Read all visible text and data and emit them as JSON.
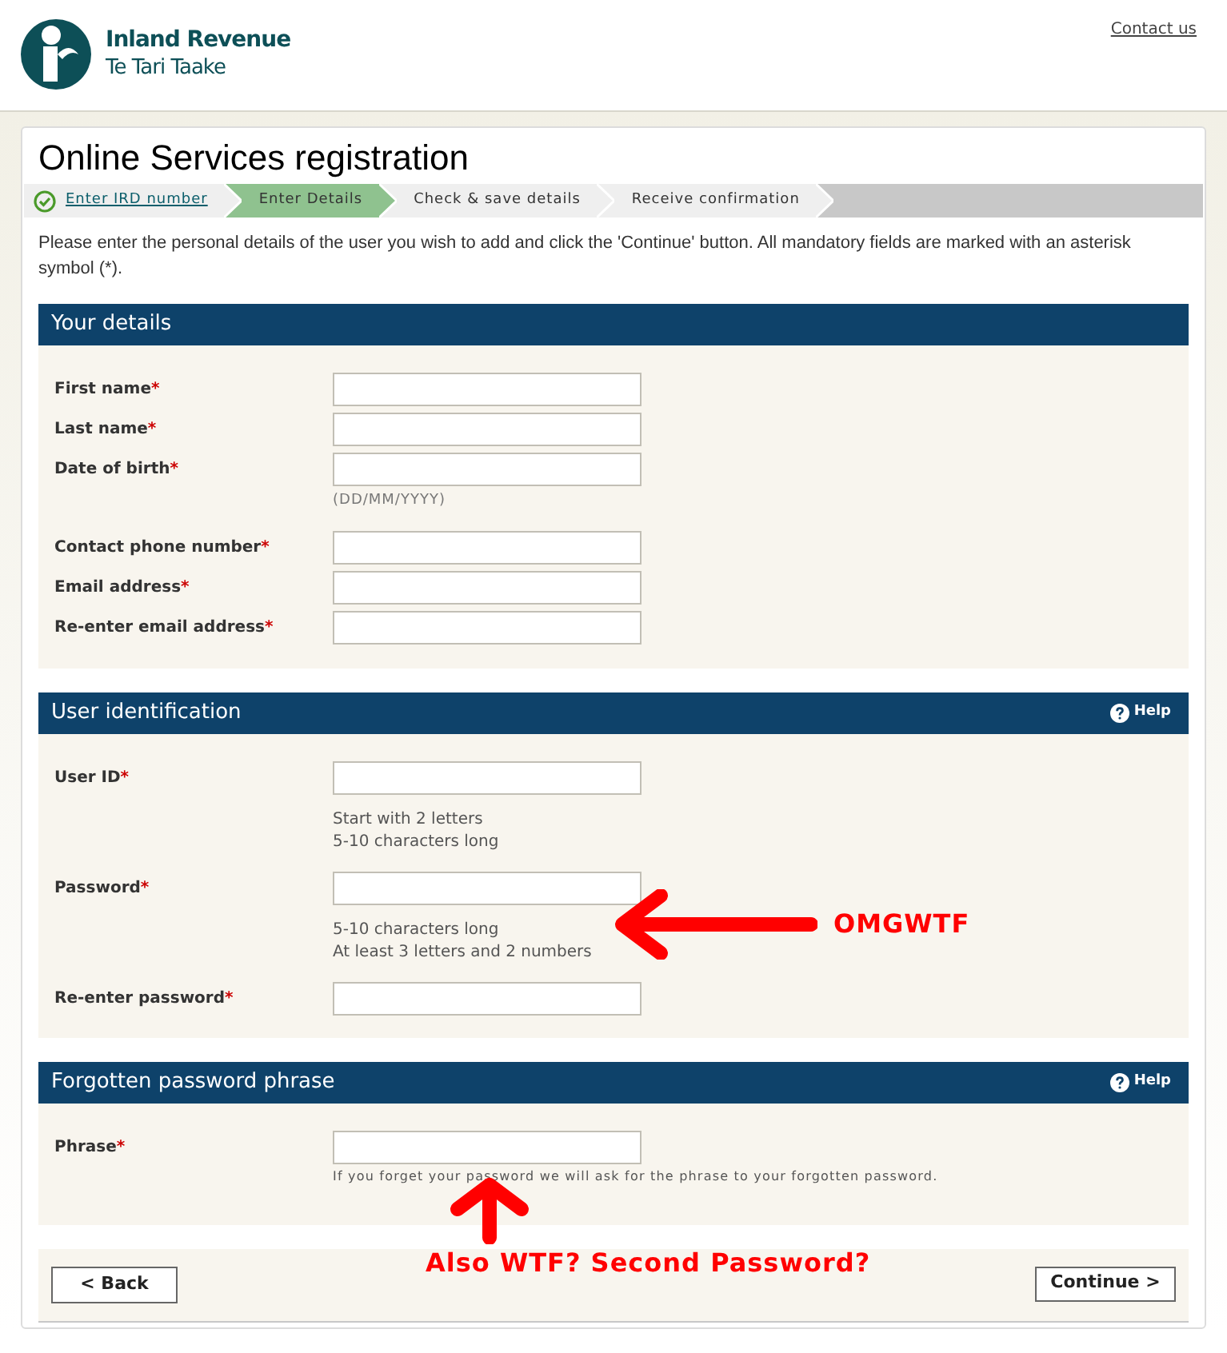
{
  "header": {
    "brand": "Inland Revenue",
    "brand_subtitle": "Te Tari Taake",
    "contact_link": "Contact us"
  },
  "page_title": "Online Services registration",
  "required_mark": "*",
  "steps": [
    {
      "label": "Enter IRD number",
      "completed": true,
      "selected": false
    },
    {
      "label": "Enter Details",
      "completed": false,
      "selected": true
    },
    {
      "label": "Check & save details",
      "completed": false,
      "selected": false
    },
    {
      "label": "Receive confirmation",
      "completed": false,
      "selected": false
    }
  ],
  "intro": "Please enter the personal details of the user you wish to add and click the 'Continue' button. All mandatory fields are marked with an asterisk symbol (*).",
  "sections": [
    {
      "title": "Your details",
      "fields": [
        {
          "label": "First name",
          "required": true
        },
        {
          "label": "Last name",
          "required": true
        },
        {
          "label": "Date of birth",
          "required": true,
          "hint": [
            "(DD/MM/YYYY)"
          ]
        },
        {
          "label": "Contact phone number",
          "required": true
        },
        {
          "label": "Email address",
          "required": true
        },
        {
          "label": "Re-enter email address",
          "required": true
        }
      ]
    },
    {
      "title": "User identification",
      "help": "Help",
      "fields": [
        {
          "label": "User ID",
          "required": true,
          "hint": [
            "Start with 2 letters",
            "5-10 characters long"
          ]
        },
        {
          "label": "Password",
          "required": true,
          "hint": [
            "5-10 characters long",
            "At least 3 letters and 2 numbers"
          ]
        },
        {
          "label": "Re-enter password",
          "required": true
        }
      ]
    },
    {
      "title": "Forgotten password phrase",
      "help": "Help",
      "fields": [
        {
          "label": "Phrase",
          "required": true,
          "hint": [
            "If you forget your password we will ask for the phrase to your forgotten password."
          ]
        }
      ]
    }
  ],
  "buttons": {
    "back": "< Back",
    "continue": "Continue >"
  },
  "annotations": [
    {
      "kind": "left",
      "text": "OMGWTF"
    },
    {
      "kind": "up",
      "text": "Also WTF? Second Password?"
    }
  ]
}
